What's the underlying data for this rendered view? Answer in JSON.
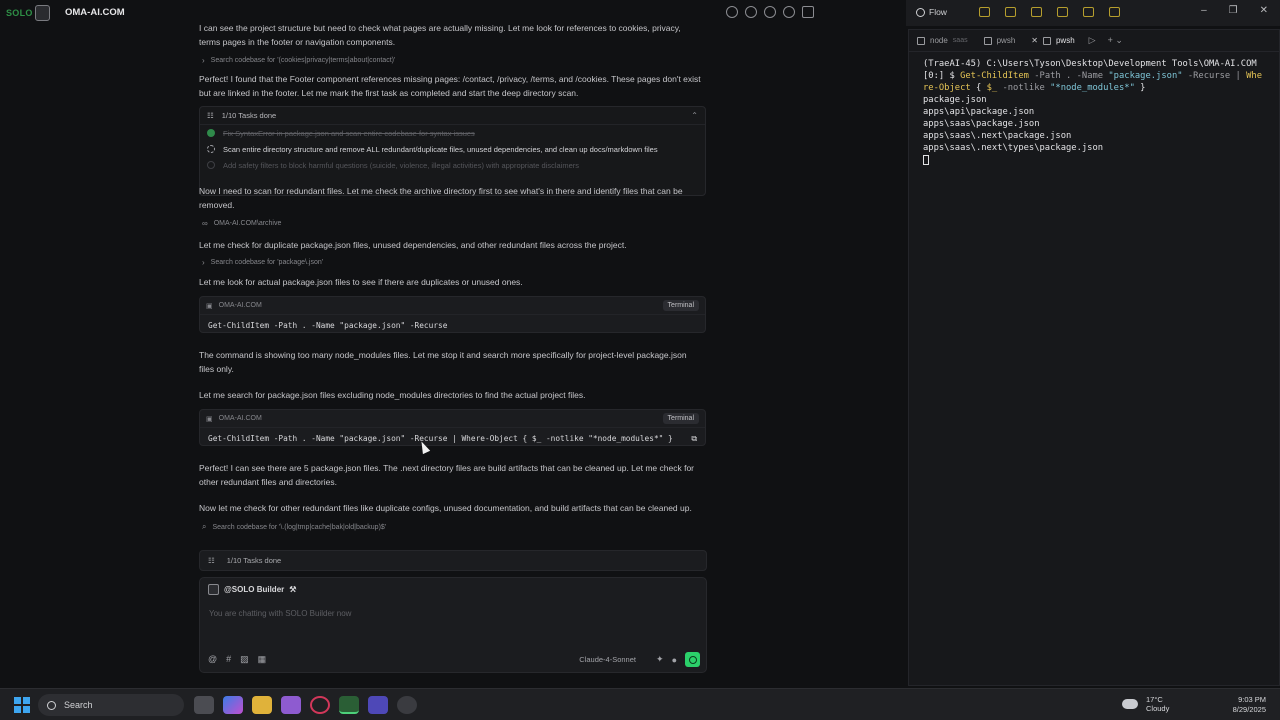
{
  "window": {
    "app_title": "OMA-AI.COM",
    "logo_text": "SOLO"
  },
  "chat": {
    "p1": "I can see the project structure but need to check what pages are actually missing. Let me look for references to cookies, privacy, terms pages in the footer or navigation components.",
    "tool1": "Search codebase for '(cookies|privacy|terms|about|contact)'",
    "p2": "Perfect! I found that the Footer component references missing pages: /contact, /privacy, /terms, and /cookies. These pages don't exist but are linked in the footer. Let me mark the first task as completed and start the deep directory scan.",
    "tasks_header": "1/10 Tasks done",
    "tasks": [
      {
        "label": "Fix SyntaxError in package.json and scan entire codebase for syntax issues",
        "state": "done"
      },
      {
        "label": "Scan entire directory structure and remove ALL redundant/duplicate files, unused dependencies, and clean up docs/markdown files",
        "state": "active"
      },
      {
        "label": "Add safety filters to block harmful questions (suicide, violence, illegal activities) with appropriate disclaimers",
        "state": "pending"
      }
    ],
    "p3": "Now I need to scan for redundant files. Let me check the archive directory first to see what's in there and identify files that can be removed.",
    "tool2": "OMA-AI.COM\\archive",
    "p4": "Let me check for duplicate package.json files, unused dependencies, and other redundant files across the project.",
    "tool3": "Search codebase for 'package\\.json'",
    "p5": "Let me look for actual package.json files to see if there are duplicates or unused ones.",
    "card1": {
      "project": "OMA-AI.COM",
      "badge": "Terminal",
      "command": "Get-ChildItem -Path . -Name \"package.json\" -Recurse"
    },
    "p6": "The command is showing too many node_modules files. Let me stop it and search more specifically for project-level package.json files only.",
    "p7": "Let me search for package.json files excluding node_modules directories to find the actual project files.",
    "card2": {
      "project": "OMA-AI.COM",
      "badge": "Terminal",
      "command": "Get-ChildItem -Path . -Name \"package.json\" -Recurse | Where-Object { $_ -notlike \"*node_modules*\" }"
    },
    "p8": "Perfect! I can see there are 5 package.json files. The .next directory files are build artifacts that can be cleaned up. Let me check for other redundant files and directories.",
    "p9": "Now let me check for other redundant files like duplicate configs, unused documentation, and build artifacts that can be cleaned up.",
    "tool4": "Search codebase for '\\.(log|tmp|cache|bak|old|backup)$'"
  },
  "composer": {
    "tasks_done": "1/10 Tasks done",
    "agent": "@SOLO Builder",
    "placeholder": "You are chatting with SOLO Builder now",
    "model": "Claude-4-Sonnet"
  },
  "right_panel": {
    "flow_label": "Flow",
    "tabs": [
      {
        "label": "node",
        "sub": "saas"
      },
      {
        "label": "pwsh",
        "sub": ""
      },
      {
        "label": "pwsh",
        "sub": ""
      }
    ],
    "terminal": {
      "prompt": "(TraeAI-45) C:\\Users\\Tyson\\Desktop\\Development Tools\\OMA-AI.COM",
      "cmd_prefix": "[0:] $ ",
      "cmd_name": "Get-ChildItem",
      "cmd_arg1": " -Path . -Name ",
      "cmd_str1": "\"package.json\"",
      "cmd_arg2": " -Recurse | ",
      "cmd_name2": "Whe",
      "cmd_cont": "re-Object",
      "cmd_rest1": " { ",
      "cmd_var": "$_",
      "cmd_arg3": " -notlike ",
      "cmd_str2": "\"*node_modules*\"",
      "cmd_rest2": " }",
      "output": [
        "package.json",
        "apps\\api\\package.json",
        "apps\\saas\\package.json",
        "apps\\saas\\.next\\package.json",
        "apps\\saas\\.next\\types\\package.json"
      ]
    }
  },
  "taskbar": {
    "search_label": "Search",
    "weather_temp": "17°C",
    "weather_desc": "Cloudy",
    "time": "9:03 PM",
    "date": "8/29/2025",
    "colors": {
      "accent": "#2bd06a",
      "start": "#3ea6f0"
    }
  }
}
